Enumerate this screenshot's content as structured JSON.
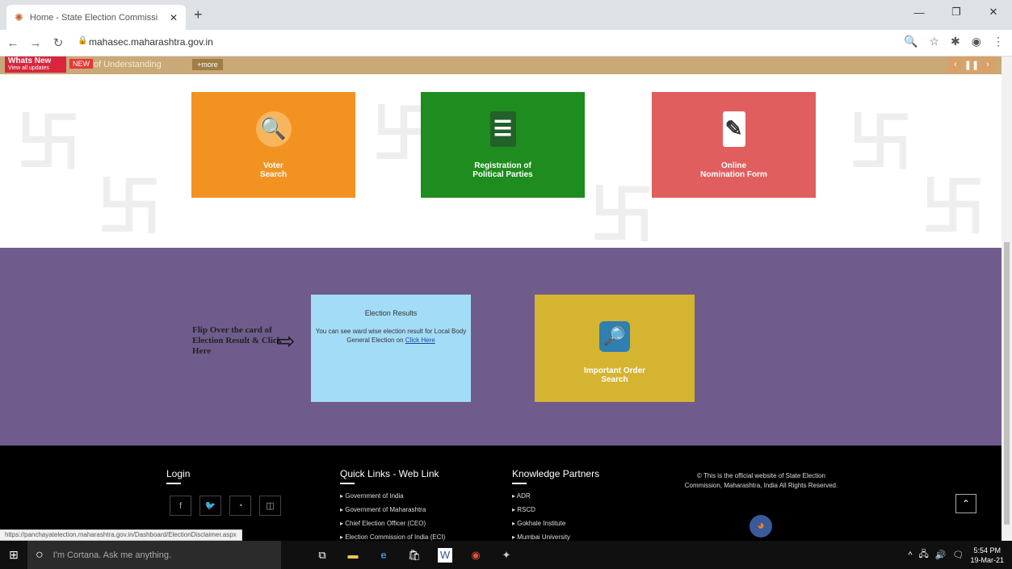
{
  "browser": {
    "tab_title": "Home - State Election Commissi",
    "new_tab": "+",
    "url": "mahasec.maharashtra.gov.in",
    "status_url": "https://panchayatelection.maharashtra.gov.in/Dashboard/ElectionDisclaimer.aspx"
  },
  "ticker": {
    "whats_new": "Whats New",
    "view_all": "View all updates",
    "new_badge": "NEW",
    "text": "of Understanding",
    "more": "+more"
  },
  "cards": {
    "voter": "Voter Search",
    "registration_line1": "Registration of",
    "registration_line2": "Political Parties",
    "nomination_line1": "Online",
    "nomination_line2": "Nomination Form",
    "order_line1": "Important Order",
    "order_line2": "Search"
  },
  "flip_note": "Flip Over the card of Election Result & Click Here",
  "election": {
    "title": "Election Results",
    "desc": "You can see ward wise election result for Local Body General Election on",
    "link": "Click Here"
  },
  "footer": {
    "login_heading": "Login",
    "quick_links_heading": "Quick Links - Web Link",
    "quick_links": [
      "Government of India",
      "Government of Maharashtra",
      "Chief Election Officer (CEO)",
      "Election Commission of India (ECI)"
    ],
    "partners_heading": "Knowledge Partners",
    "partners": [
      "ADR",
      "RSCD",
      "Gokhale Institute",
      "Mumbai University"
    ],
    "official_text": "© This is the official website of State Election Commission, Maharashtra, India All Rights Reserved."
  },
  "taskbar": {
    "cortana": "I'm Cortana. Ask me anything.",
    "time": "5:54 PM",
    "date": "19-Mar-21"
  }
}
